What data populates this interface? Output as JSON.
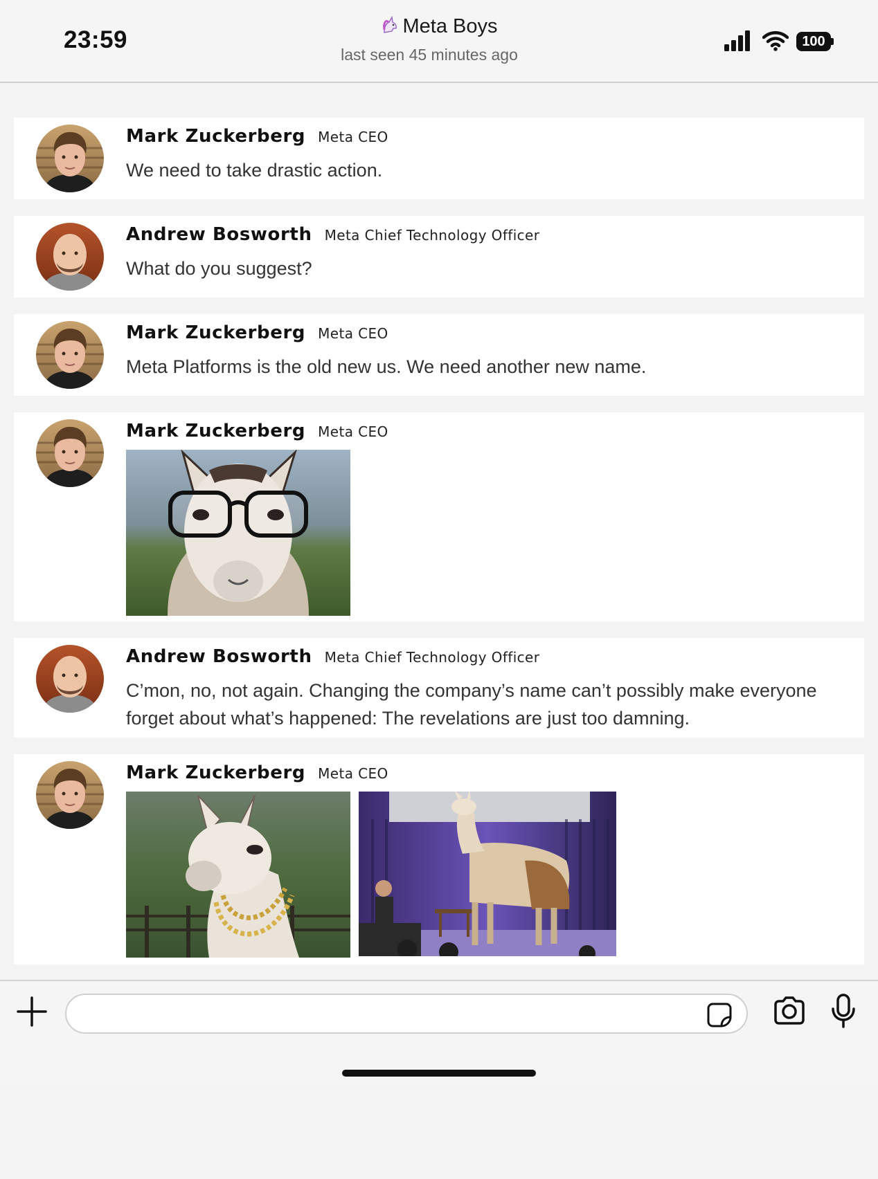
{
  "status_bar": {
    "time": "23:59",
    "battery": "100"
  },
  "chat": {
    "title": "Meta Boys",
    "subtitle": "last seen 45 minutes ago"
  },
  "messages": [
    {
      "sender": "Mark Zuckerberg",
      "role": "Meta CEO",
      "text": "We need to take drastic action."
    },
    {
      "sender": "Andrew Bosworth",
      "role": "Meta Chief Technology Officer",
      "text": "What do you suggest?"
    },
    {
      "sender": "Mark Zuckerberg",
      "role": "Meta CEO",
      "text": "Meta Platforms is the old new us. We need another new name."
    },
    {
      "sender": "Mark Zuckerberg",
      "role": "Meta CEO",
      "attachment": "llama-with-glasses-photo"
    },
    {
      "sender": "Andrew Bosworth",
      "role": "Meta Chief Technology Officer",
      "text": "C’mon, no, not again. Changing the company’s name can’t possibly make everyone forget about what’s happened: The revelations are just too damning."
    },
    {
      "sender": "Mark Zuckerberg",
      "role": "Meta CEO",
      "attachments": [
        "llama-with-gold-chain-photo",
        "llama-on-stage-photo"
      ]
    }
  ],
  "composer": {
    "placeholder": ""
  },
  "icons": {
    "title_emoji": "unicorn-icon",
    "composer_left": "plus-icon",
    "composer_sticker": "sticker-icon",
    "composer_camera": "camera-icon",
    "composer_mic": "microphone-icon"
  }
}
